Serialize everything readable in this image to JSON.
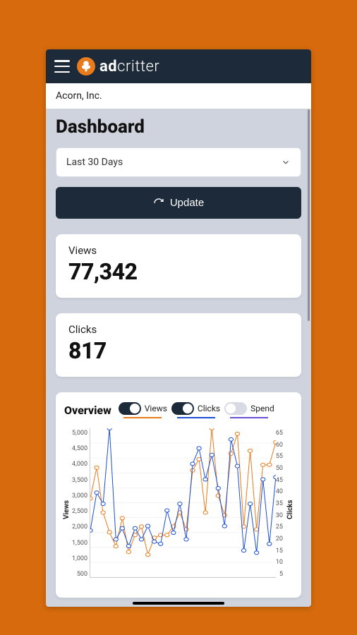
{
  "brand": {
    "prefix": "ad",
    "suffix": "critter"
  },
  "company": "Acorn, Inc.",
  "page_title": "Dashboard",
  "date_range": {
    "selected": "Last 30 Days"
  },
  "update_button": "Update",
  "stats": {
    "views": {
      "label": "Views",
      "value": "77,342"
    },
    "clicks": {
      "label": "Clicks",
      "value": "817"
    }
  },
  "overview": {
    "title": "Overview",
    "legend": {
      "views": {
        "label": "Views",
        "on": true
      },
      "clicks": {
        "label": "Clicks",
        "on": true
      },
      "spend": {
        "label": "Spend",
        "on": false
      }
    },
    "axes": {
      "left_label": "Views",
      "right_label": "Clicks",
      "left_ticks": [
        "5,000",
        "4,500",
        "4,000",
        "3,500",
        "3,000",
        "2,500",
        "2,000",
        "1,500",
        "1,000",
        "500"
      ],
      "right_ticks": [
        "65",
        "60",
        "55",
        "50",
        "45",
        "40",
        "35",
        "30",
        "25",
        "20",
        "15",
        "10",
        "5"
      ]
    }
  },
  "chart_data": {
    "type": "line",
    "x": [
      1,
      2,
      3,
      4,
      5,
      6,
      7,
      8,
      9,
      10,
      11,
      12,
      13,
      14,
      15,
      16,
      17,
      18,
      19,
      20,
      21,
      22,
      23,
      24,
      25,
      26,
      27,
      28,
      29,
      30
    ],
    "series": [
      {
        "name": "Views",
        "axis": "left",
        "color": "#e87b1b",
        "values": [
          2800,
          3900,
          2300,
          1600,
          1100,
          2100,
          900,
          1500,
          1800,
          800,
          1400,
          1500,
          1500,
          1800,
          2300,
          1700,
          3800,
          4200,
          2300,
          5300,
          2900,
          2200,
          4400,
          5100,
          1800,
          4500,
          1700,
          4000,
          4000,
          4800
        ]
      },
      {
        "name": "Clicks",
        "axis": "right",
        "color": "#1b4fd6",
        "values": [
          21,
          38,
          33,
          67,
          17,
          22,
          14,
          22,
          17,
          23,
          16,
          15,
          30,
          20,
          33,
          17,
          51,
          58,
          44,
          55,
          40,
          23,
          62,
          50,
          12,
          33,
          11,
          44,
          15,
          45
        ]
      }
    ],
    "title": "Overview",
    "left_ylabel": "Views",
    "right_ylabel": "Clicks",
    "left_ylim": [
      0,
      5300
    ],
    "right_ylim": [
      0,
      67
    ]
  }
}
